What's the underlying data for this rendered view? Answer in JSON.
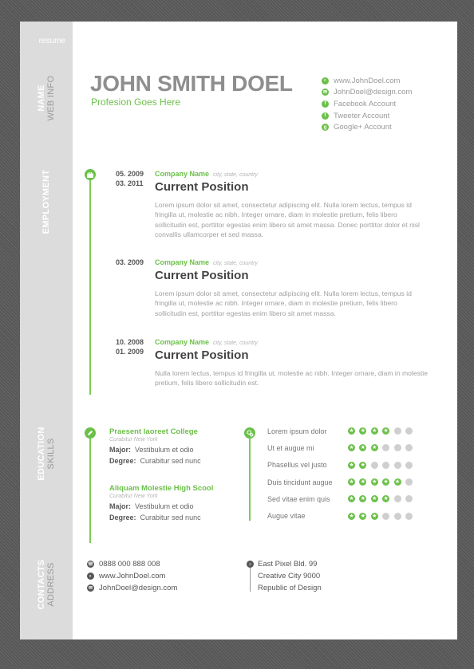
{
  "colors": {
    "accent": "#6cc04a",
    "sidebar": "#dcdcdc",
    "name": "#8e8e8e",
    "background": "#5e5e5e"
  },
  "sidebar": {
    "brand": "resume",
    "sections": [
      {
        "line1": "NAME",
        "line2": "WEB INFO"
      },
      {
        "line1": "EMPLOYMENT",
        "line2": ""
      },
      {
        "line1": "EDUCATION",
        "line2": "SKILLS"
      },
      {
        "line1": "CONTACTS",
        "line2": "ADDRESS"
      }
    ]
  },
  "header": {
    "name": "JOHN SMITH DOEL",
    "profession": "Profesion Goes Here",
    "web_info": [
      {
        "icon": "globe-icon",
        "text": "www.JohnDoel.com"
      },
      {
        "icon": "email-icon",
        "text": "JohnDoel@design.com"
      },
      {
        "icon": "facebook-icon",
        "text": "Facebook Account"
      },
      {
        "icon": "twitter-icon",
        "text": "Tweeter Account"
      },
      {
        "icon": "google-plus-icon",
        "text": "Google+ Account"
      }
    ]
  },
  "employment": [
    {
      "date_from": "05. 2009",
      "date_to": "03. 2011",
      "company": "Company Name",
      "location": "city,  state,  country",
      "position": "Current Position",
      "description": "Lorem ipsum dolor sit amet, consectetur adipiscing elit. Nulla lorem lectus, tempus id fringilla ut, molestie ac nibh. Integer ornare, diam in molestie pretium, felis libero sollicitudin est, porttitor egestas enim libero sit amet massa. Donec porttitor dolor et nisl convallis ullamcorper et sed massa."
    },
    {
      "date_from": "03. 2009",
      "date_to": "",
      "company": "Company Name",
      "location": "city,  state,  country",
      "position": "Current Position",
      "description": "Lorem ipsum dolor sit amet, consectetur adipiscing elit. Nulla lorem lectus, tempus id fringilla ut, molestie ac nibh. Integer ornare, diam in molestie pretium, felis libero sollicitudin est, porttitor egestas enim libero sit amet massa."
    },
    {
      "date_from": "10. 2008",
      "date_to": "01. 2009",
      "company": "Company Name",
      "location": "city,  state,  country",
      "position": "Current Position",
      "description": "Nulla lorem lectus, tempus id fringilla ut, molestie ac nibh. Integer ornare, diam in molestie pretium, felis libero sollicitudin est."
    }
  ],
  "education": [
    {
      "school": "Praesent laoreet College",
      "location": "Curabitur  New York",
      "major_label": "Major:",
      "major": "Vestibulum et odio",
      "degree_label": "Degree:",
      "degree": "Curabitur sed nunc"
    },
    {
      "school": "Aliquam Molestie High Scool",
      "location": "Curabitur  New York",
      "major_label": "Major:",
      "major": "Vestibulum et odio",
      "degree_label": "Degree:",
      "degree": "Curabitur sed nunc"
    }
  ],
  "skills": {
    "max": 6,
    "items": [
      {
        "name": "Lorem ipsum dolor",
        "rating": 4
      },
      {
        "name": "Ut et augue mi",
        "rating": 3
      },
      {
        "name": "Phasellus vel justo",
        "rating": 2
      },
      {
        "name": "Duis tincidunt augue",
        "rating": 5
      },
      {
        "name": "Sed vitae enim quis",
        "rating": 4
      },
      {
        "name": "Augue vitae",
        "rating": 3
      }
    ]
  },
  "contacts": [
    {
      "icon": "phone-icon",
      "text": "0888 000 888 008"
    },
    {
      "icon": "globe-icon",
      "text": "www.JohnDoel.com"
    },
    {
      "icon": "email-icon",
      "text": "JohnDoel@design.com"
    }
  ],
  "address": {
    "icon": "home-icon",
    "lines": [
      "East Pixel Bld. 99",
      "Creative City 9000",
      "Republic of Design"
    ]
  }
}
